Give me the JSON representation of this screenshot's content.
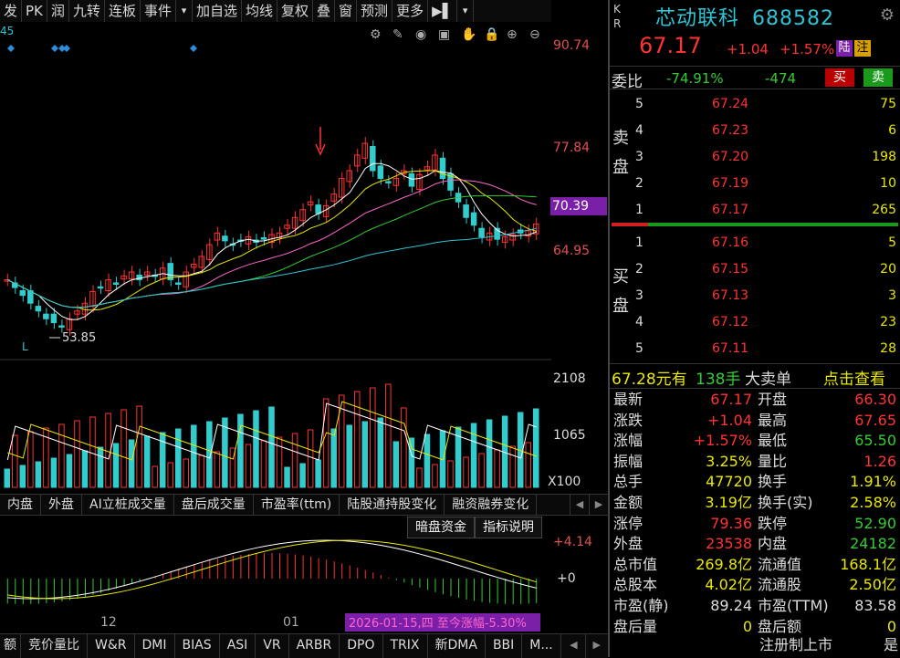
{
  "toolbar": {
    "items": [
      "发",
      "PK",
      "润",
      "九转",
      "连板",
      "事件",
      "▾",
      "加自选",
      "均线",
      "复权",
      "叠",
      "窗",
      "预测",
      "更多",
      "▶▌",
      "▾"
    ]
  },
  "chart": {
    "top_left_value": "45",
    "min_marker": "53.85",
    "min_marker_flag": "L",
    "axis_right": [
      "90.74",
      "77.84",
      "70.39",
      "64.95"
    ],
    "vol_axis": [
      "2108",
      "1065",
      "X100"
    ],
    "macd_axis": [
      "+4.14",
      "+0"
    ],
    "date_labels": [
      "12",
      "01"
    ],
    "date_overlay": "2026-01-15,四 至今涨幅-5.30%",
    "toolbar_icons": [
      "settings-icon",
      "pen-icon",
      "eye-icon",
      "basket-icon",
      "hand-icon",
      "lock-icon",
      "zoom-in-icon",
      "zoom-out-icon"
    ]
  },
  "indicator_tabs": [
    "内盘",
    "外盘",
    "AI立桩成交量",
    "盘后成交量",
    "市盈率(ttm)",
    "陆股通持股变化",
    "融资融券变化"
  ],
  "sub_buttons": [
    "暗盘资金",
    "指标说明"
  ],
  "bottom_tabs": [
    "竞价量比",
    "W&R",
    "DMI",
    "BIAS",
    "ASI",
    "VR",
    "ARBR",
    "DPO",
    "TRIX",
    "新DMA",
    "BBI",
    "M..."
  ],
  "bottom_left": "额",
  "quote": {
    "kr": [
      "K",
      "R"
    ],
    "name": "芯动联科",
    "code": "688582",
    "price": "67.17",
    "change": "+1.04",
    "change_pct": "+1.57%",
    "tag1": "陆",
    "tag2": "注",
    "weibi_label": "委比",
    "weibi_pct": "-74.91%",
    "weibi_diff": "-474",
    "buy_btn": "买",
    "sell_btn": "卖",
    "sell_side_label": [
      "卖",
      "盘"
    ],
    "buy_side_label": [
      "买",
      "盘"
    ],
    "asks": [
      {
        "lv": "5",
        "price": "67.24",
        "vol": "75"
      },
      {
        "lv": "4",
        "price": "67.23",
        "vol": "6"
      },
      {
        "lv": "3",
        "price": "67.20",
        "vol": "198"
      },
      {
        "lv": "2",
        "price": "67.19",
        "vol": "10"
      },
      {
        "lv": "1",
        "price": "67.17",
        "vol": "265"
      }
    ],
    "bids": [
      {
        "lv": "1",
        "price": "67.16",
        "vol": "5"
      },
      {
        "lv": "2",
        "price": "67.15",
        "vol": "20"
      },
      {
        "lv": "3",
        "price": "67.13",
        "vol": "3"
      },
      {
        "lv": "4",
        "price": "67.12",
        "vol": "23"
      },
      {
        "lv": "5",
        "price": "67.11",
        "vol": "28"
      }
    ],
    "trade_price": "67.28元有",
    "trade_vol": "138手",
    "trade_label": "大卖单",
    "trade_link": "点击查看"
  },
  "stats_left": [
    {
      "k": "最新",
      "v": "67.17",
      "c": "red"
    },
    {
      "k": "涨跌",
      "v": "+1.04",
      "c": "red"
    },
    {
      "k": "涨幅",
      "v": "+1.57%",
      "c": "red"
    },
    {
      "k": "振幅",
      "v": "3.25%",
      "c": "yellow"
    },
    {
      "k": "总手",
      "v": "47720",
      "c": "yellow"
    },
    {
      "k": "金额",
      "v": "3.19亿",
      "c": "yellow"
    },
    {
      "k": "涨停",
      "v": "79.36",
      "c": "red"
    },
    {
      "k": "外盘",
      "v": "23538",
      "c": "red"
    },
    {
      "k": "总市值",
      "v": "269.8亿",
      "c": "yellow"
    },
    {
      "k": "总股本",
      "v": "4.02亿",
      "c": "yellow"
    },
    {
      "k": "市盈(静)",
      "v": "89.24",
      "c": "white"
    },
    {
      "k": "盘后量",
      "v": "0",
      "c": "yellow"
    }
  ],
  "stats_right": [
    {
      "k": "开盘",
      "v": "66.30",
      "c": "red"
    },
    {
      "k": "最高",
      "v": "67.65",
      "c": "red"
    },
    {
      "k": "最低",
      "v": "65.50",
      "c": "green"
    },
    {
      "k": "量比",
      "v": "1.26",
      "c": "red"
    },
    {
      "k": "换手",
      "v": "1.91%",
      "c": "yellow"
    },
    {
      "k": "换手(实)",
      "v": "2.58%",
      "c": "yellow"
    },
    {
      "k": "跌停",
      "v": "52.90",
      "c": "green"
    },
    {
      "k": "内盘",
      "v": "24182",
      "c": "green"
    },
    {
      "k": "流通值",
      "v": "168.1亿",
      "c": "yellow"
    },
    {
      "k": "流通股",
      "v": "2.50亿",
      "c": "yellow"
    },
    {
      "k": "市盈(TTM)",
      "v": "83.58",
      "c": "white"
    },
    {
      "k": "盘后额",
      "v": "0",
      "c": "yellow"
    }
  ],
  "footer_right": [
    "注册制上市",
    "是"
  ],
  "colors": {
    "up": "#ff3333",
    "down": "#33cccc",
    "accent": "#7a1fa8"
  }
}
